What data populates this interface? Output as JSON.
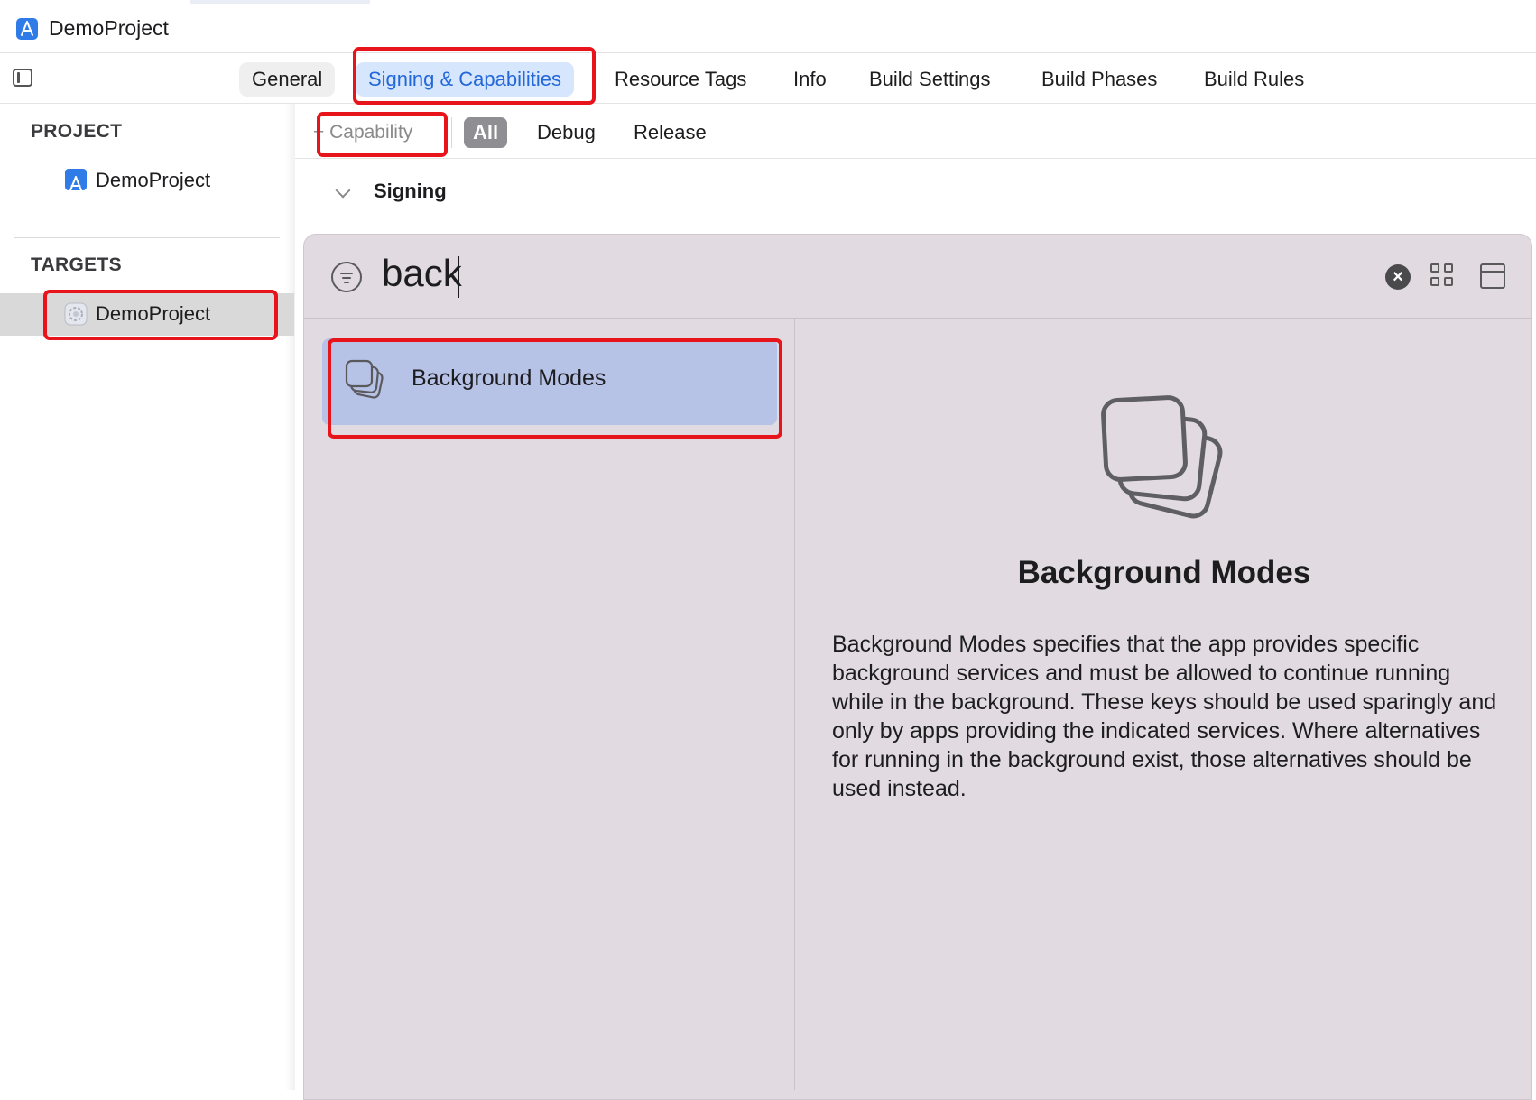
{
  "window": {
    "title": "DemoProject"
  },
  "tabs": [
    {
      "label": "General"
    },
    {
      "label": "Signing & Capabilities"
    },
    {
      "label": "Resource Tags"
    },
    {
      "label": "Info"
    },
    {
      "label": "Build Settings"
    },
    {
      "label": "Build Phases"
    },
    {
      "label": "Build Rules"
    }
  ],
  "active_tab": "Signing & Capabilities",
  "sidebar": {
    "project_header": "PROJECT",
    "project_item": "DemoProject",
    "targets_header": "TARGETS",
    "target_item": "DemoProject"
  },
  "editor": {
    "add_capability_label": "+ Capability",
    "configs": [
      "All",
      "Debug",
      "Release"
    ],
    "selected_config": "All",
    "section_title": "Signing"
  },
  "library": {
    "search_value": "back",
    "results": [
      {
        "label": "Background Modes"
      }
    ],
    "detail": {
      "title": "Background Modes",
      "description": "Background Modes specifies that the app provides specific background services and must be allowed to continue running while in the background. These keys should be used sparingly and only by apps providing the indicated services. Where alternatives for running in the background exist, those alternatives should be used instead."
    }
  },
  "colors": {
    "accent": "#2367d8",
    "active_tab_bg": "#d6e6fd",
    "library_bg": "#e1dbe1",
    "selected_result_bg": "#b6c2e6",
    "annotation_red": "#e8141c"
  },
  "icons": {
    "app": "xcode-app-icon",
    "target": "target-gear-icon",
    "filter": "filter-icon",
    "clear": "clear-search-icon",
    "grid": "grid-view-icon",
    "detail": "detail-pane-icon",
    "capability": "background-modes-stack-icon"
  }
}
